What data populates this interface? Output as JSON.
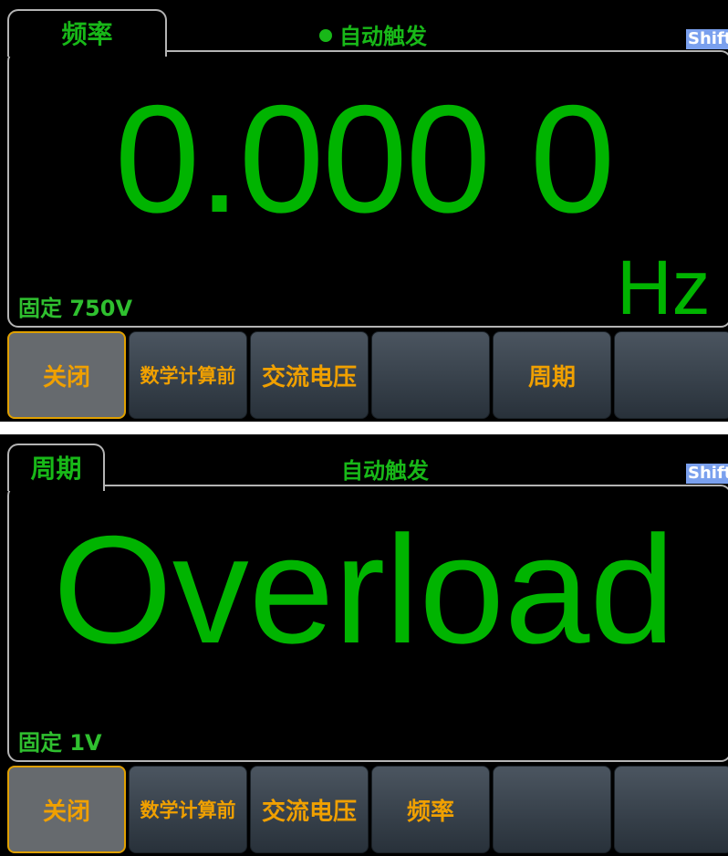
{
  "screens": [
    {
      "tab_title": "频率",
      "trigger_text": "自动触发",
      "trigger_indicator": true,
      "shift_label": "Shift",
      "reading": "0.000 0",
      "unit": "Hz",
      "range_text": "固定 750V",
      "softkeys": [
        {
          "label": "关闭",
          "active": true
        },
        {
          "label": "数学计算前",
          "active": false
        },
        {
          "label": "交流电压",
          "active": false
        },
        {
          "label": "",
          "active": false
        },
        {
          "label": "周期",
          "active": false
        },
        {
          "label": "",
          "active": false
        }
      ]
    },
    {
      "tab_title": "周期",
      "trigger_text": "自动触发",
      "trigger_indicator": false,
      "shift_label": "Shift",
      "reading": "Overload",
      "unit": "",
      "range_text": "固定 1V",
      "softkeys": [
        {
          "label": "关闭",
          "active": true
        },
        {
          "label": "数学计算前",
          "active": false
        },
        {
          "label": "交流电压",
          "active": false
        },
        {
          "label": "频率",
          "active": false
        },
        {
          "label": "",
          "active": false
        },
        {
          "label": "",
          "active": false
        }
      ]
    }
  ],
  "colors": {
    "measurement_green": "#00b400",
    "label_green": "#18b818",
    "softkey_text": "#f0a000",
    "active_border": "#e0a000",
    "shift_bg": "#7aa0ee"
  }
}
